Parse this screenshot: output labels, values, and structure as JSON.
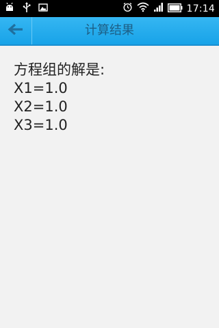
{
  "status_bar": {
    "time": "17:14",
    "left_icons": [
      "android-debug-icon",
      "usb-icon",
      "image-icon"
    ],
    "right_icons": [
      "alarm-icon",
      "wifi-icon",
      "signal-icon",
      "battery-icon"
    ]
  },
  "action_bar": {
    "title": "计算结果",
    "back_icon": "back-arrow-icon"
  },
  "result": {
    "heading": "方程组的解是:",
    "lines": [
      "X1=1.0",
      "X2=1.0",
      "X3=1.0"
    ]
  },
  "colors": {
    "action_bar": "#18a3e8",
    "title_text": "#1d5f86",
    "background": "#f2f2f2"
  }
}
